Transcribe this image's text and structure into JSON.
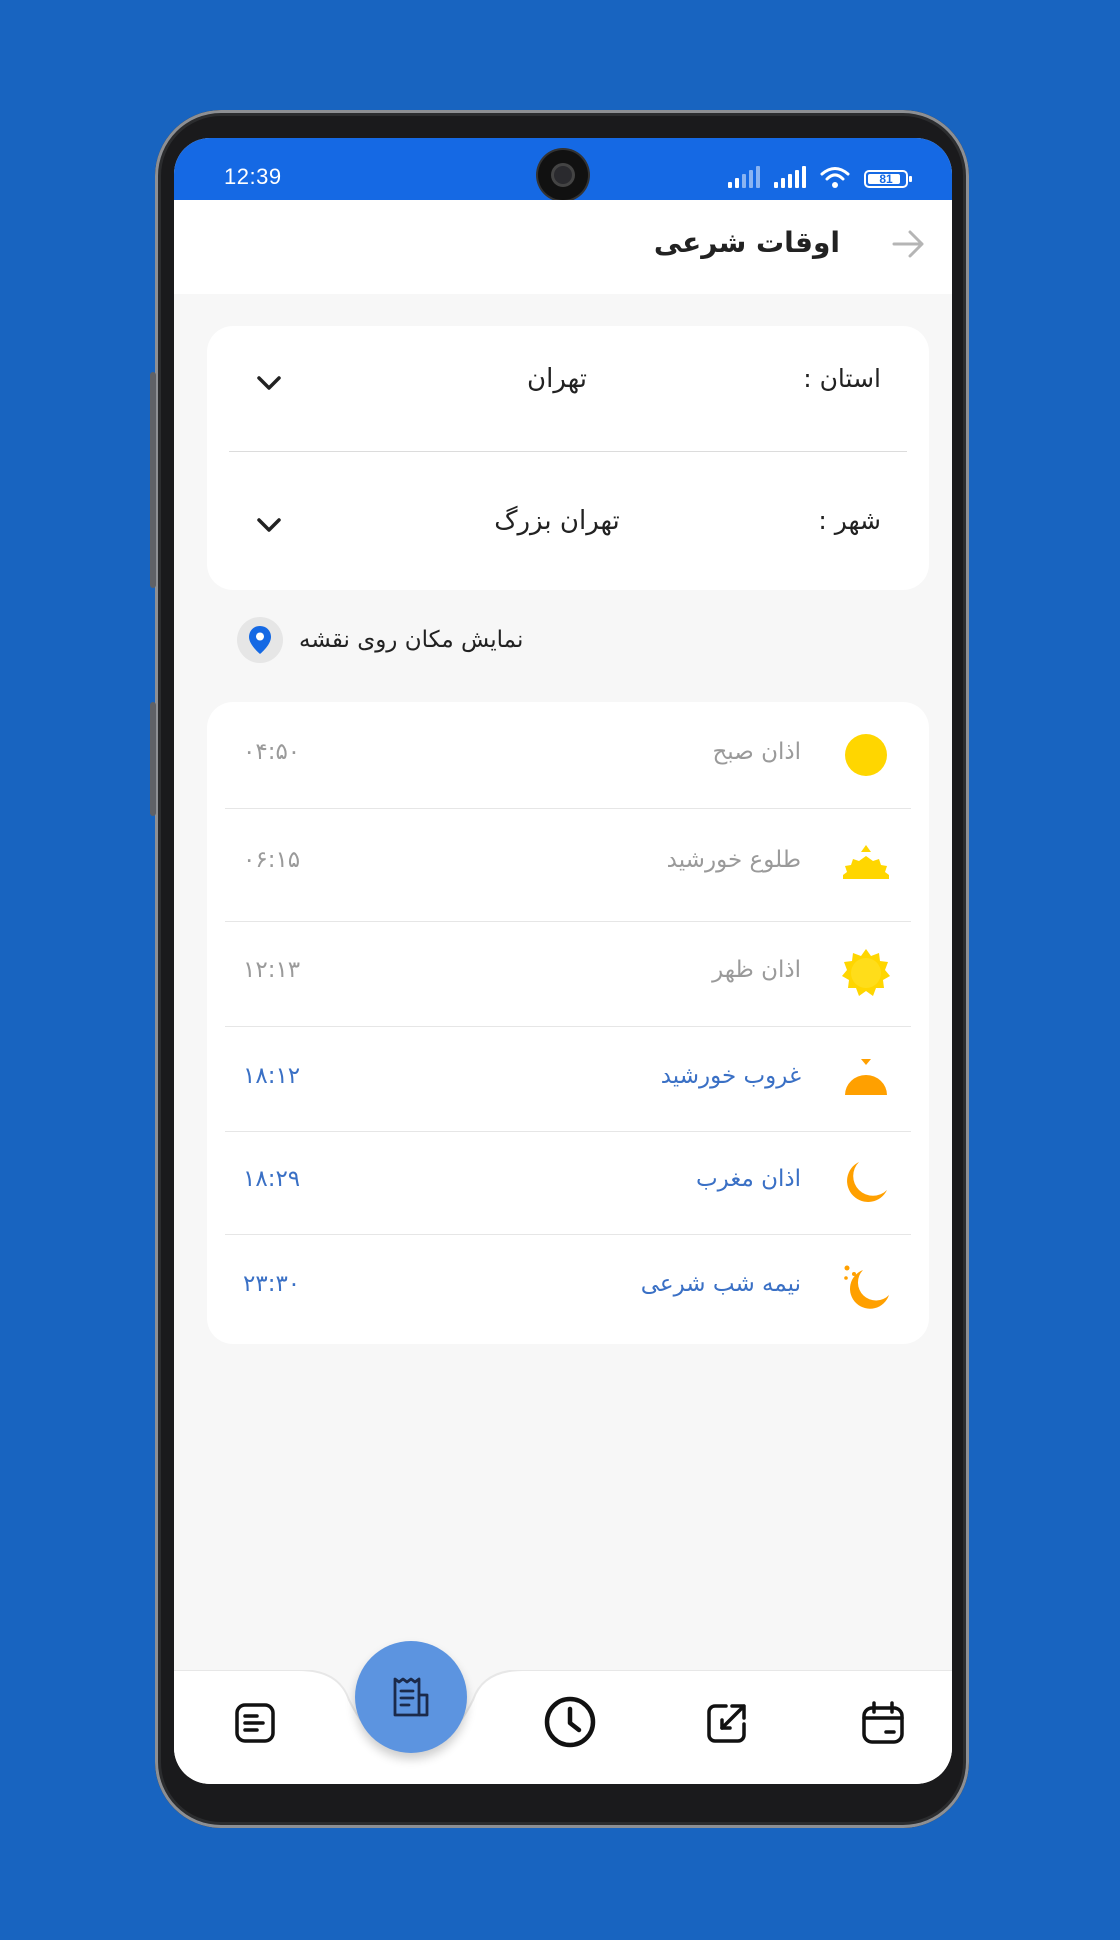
{
  "status_bar": {
    "time": "12:39",
    "battery_level": "81"
  },
  "app_bar": {
    "title": "اوقات شرعی"
  },
  "location": {
    "province_label": "استان :",
    "province_value": "تهران",
    "city_label": "شهر :",
    "city_value": "تهران بزرگ"
  },
  "map_link": {
    "label": "نمایش مکان روی نقشه"
  },
  "prayer_times": [
    {
      "name": "اذان صبح",
      "time": "۰۴:۵۰",
      "icon": "dawn-sun-icon",
      "state": "past"
    },
    {
      "name": "طلوع خورشید",
      "time": "۰۶:۱۵",
      "icon": "sunrise-icon",
      "state": "past"
    },
    {
      "name": "اذان ظهر",
      "time": "۱۲:۱۳",
      "icon": "noon-sun-icon",
      "state": "past"
    },
    {
      "name": "غروب خورشید",
      "time": "۱۸:۱۲",
      "icon": "sunset-icon",
      "state": "upcoming"
    },
    {
      "name": "اذان مغرب",
      "time": "۱۸:۲۹",
      "icon": "moon-icon",
      "state": "upcoming"
    },
    {
      "name": "نیمه شب شرعی",
      "time": "۲۳:۳۰",
      "icon": "moon-stars-icon",
      "state": "upcoming"
    }
  ],
  "bottom_nav": {
    "items": [
      "notes-icon",
      "receipt-icon",
      "clock-icon",
      "share-icon",
      "calendar-icon"
    ],
    "active": "receipt-icon"
  },
  "colors": {
    "background": "#1864c0",
    "status_bar": "#1569e4",
    "accent": "#5c94e0",
    "upcoming_text": "#3a70c5",
    "past_text": "#9a9a9a",
    "sun_yellow": "#ffd600",
    "moon_orange": "#ffa000"
  }
}
